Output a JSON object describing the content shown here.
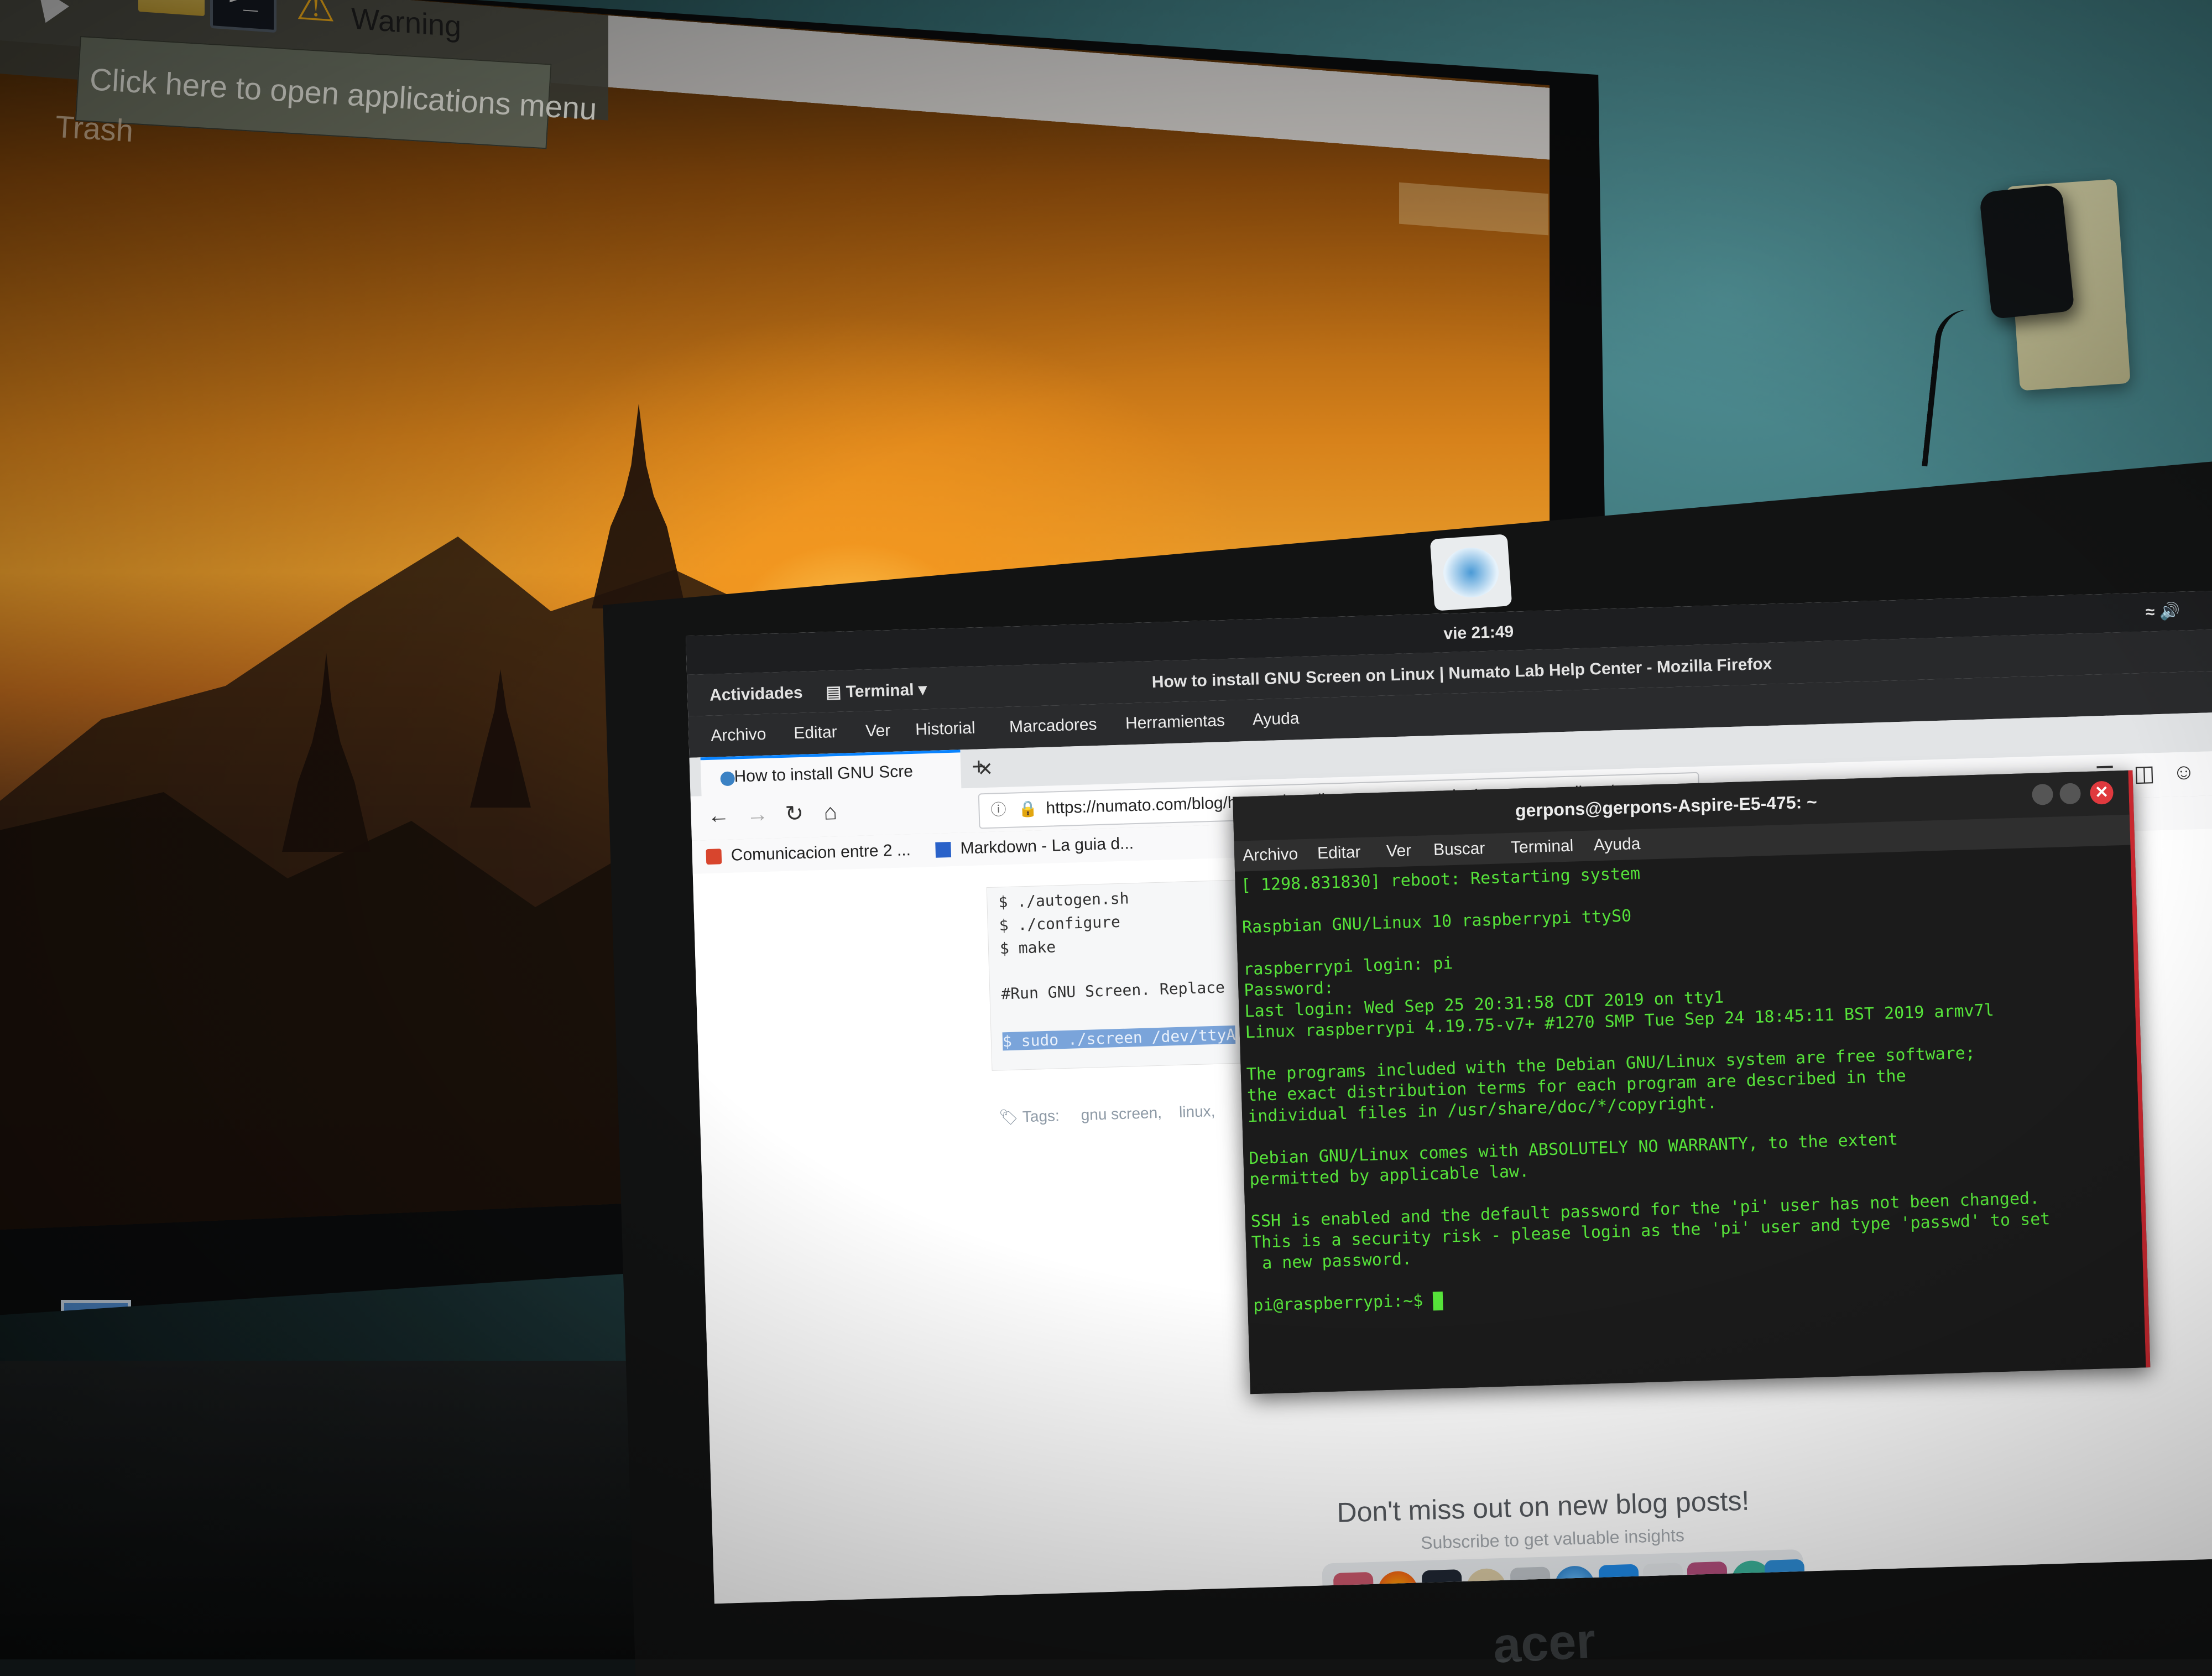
{
  "pi_desktop": {
    "warning_label": "Warning",
    "tooltip": "Click here to open applications menu",
    "trash_label": "Trash",
    "terminal_icon_glyph": ">_",
    "warning_icon_glyph": "⚠"
  },
  "gnome_bar": {
    "activities": "Actividades",
    "app_name": "Terminal",
    "clock": "vie 21:49"
  },
  "firefox": {
    "window_title": "How to install GNU Screen on Linux | Numato Lab Help Center - Mozilla Firefox",
    "menu": [
      "Archivo",
      "Editar",
      "Ver",
      "Historial",
      "Marcadores",
      "Herramientas",
      "Ayuda"
    ],
    "tab_title": "How to install GNU Scre",
    "url": "https://numato.com/blog/how-to-install-gnu-screen-terminal-program-on-linux/",
    "bookmarks": [
      "Comunicacion entre 2 ...",
      "Markdown - La guia d..."
    ],
    "code_lines": [
      "$ ./autogen.sh",
      "$ ./configure",
      "$ make",
      "",
      "#Run GNU Screen. Replace",
      "",
      "$ sudo ./screen /dev/ttyA"
    ],
    "tags_label": "Tags:",
    "tags": [
      "gnu screen,",
      "linux,"
    ],
    "blog_cta": "Don't miss out on new blog posts!",
    "blog_sub": "Subscribe to get valuable insights"
  },
  "terminal": {
    "title": "gerpons@gerpons-Aspire-E5-475: ~",
    "menu": [
      "Archivo",
      "Editar",
      "Ver",
      "Buscar",
      "Terminal",
      "Ayuda"
    ],
    "lines": [
      "[ 1298.831830] reboot: Restarting system",
      "",
      "Raspbian GNU/Linux 10 raspberrypi ttyS0",
      "",
      "raspberrypi login: pi",
      "Password:",
      "Last login: Wed Sep 25 20:31:58 CDT 2019 on tty1",
      "Linux raspberrypi 4.19.75-v7+ #1270 SMP Tue Sep 24 18:45:11 BST 2019 armv7l",
      "",
      "The programs included with the Debian GNU/Linux system are free software;",
      "the exact distribution terms for each program are described in the",
      "individual files in /usr/share/doc/*/copyright.",
      "",
      "Debian GNU/Linux comes with ABSOLUTELY NO WARRANTY, to the extent",
      "permitted by applicable law.",
      "",
      "SSH is enabled and the default password for the 'pi' user has not been changed.",
      "This is a security risk - please login as the 'pi' user and type 'passwd' to set",
      " a new password.",
      ""
    ],
    "prompt": "pi@raspberrypi:~$ "
  },
  "laptop_brand": "acer",
  "colors": {
    "terminal_green": "#56e23a",
    "terminal_close": "#e0393e",
    "firefox_accent": "#0a84ff",
    "sunset_orange": "#e89b2a"
  }
}
